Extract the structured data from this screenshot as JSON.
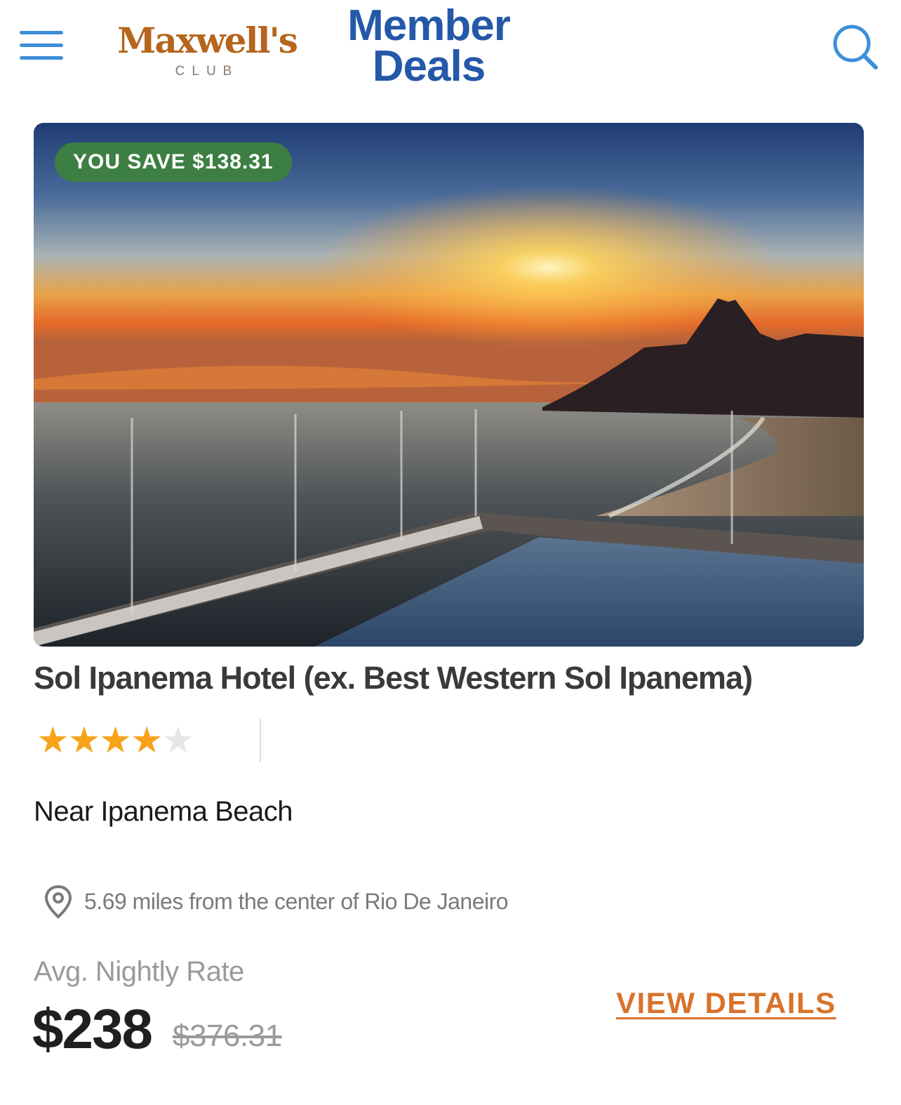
{
  "header": {
    "logo": {
      "name": "Maxwell's",
      "sub": "CLUB"
    },
    "member_deals": {
      "line1": "Member",
      "line2": "Deals"
    }
  },
  "listing": {
    "save_badge": "YOU SAVE $138.31",
    "hotel_name": "Sol Ipanema Hotel (ex. Best Western Sol Ipanema)",
    "rating": {
      "value": 4,
      "max": 5
    },
    "neighborhood": "Near Ipanema Beach",
    "distance": "5.69 miles from the center of Rio De Janeiro",
    "rate_label": "Avg. Nightly Rate",
    "price": "$238",
    "original_price": "$376.31",
    "view_details": "VIEW DETAILS"
  },
  "colors": {
    "brand_orange": "#b5651d",
    "member_blue": "#2458a8",
    "icon_blue": "#3d8fd9",
    "badge_green": "#3d7f43",
    "link_orange": "#d8732b",
    "star_filled": "#f7a21b",
    "star_empty": "#e6e6e6"
  },
  "icons": [
    "menu-icon",
    "search-icon",
    "location-pin-icon",
    "star-icon"
  ]
}
